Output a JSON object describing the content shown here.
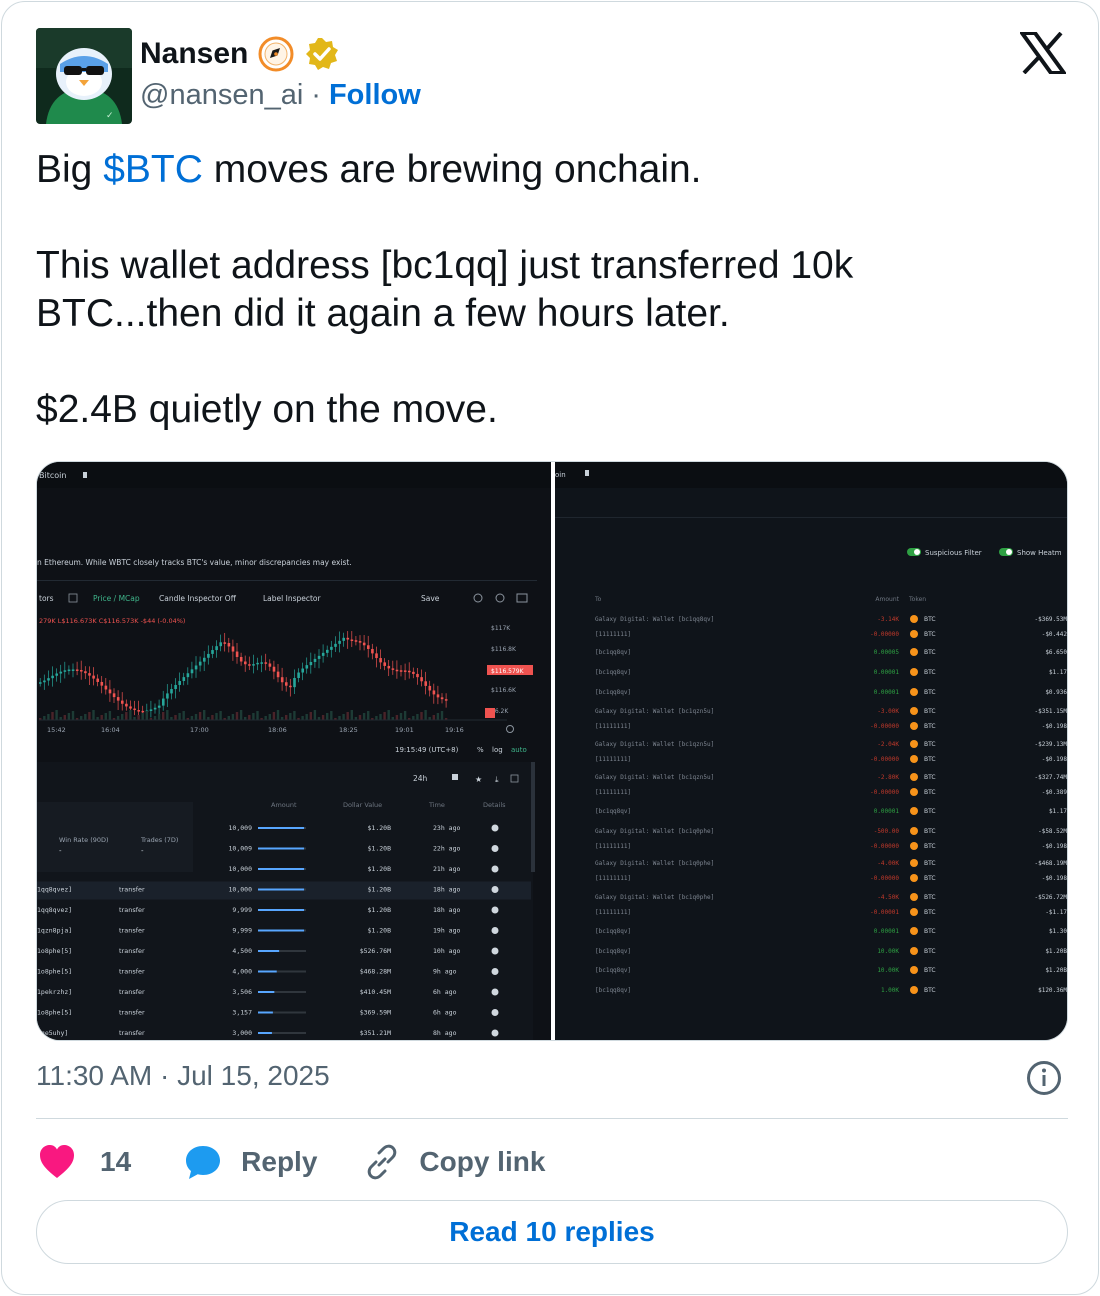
{
  "author": {
    "display_name": "Nansen",
    "handle": "@nansen_ai",
    "separator": "·",
    "follow_label": "Follow"
  },
  "tweet": {
    "line1_pre": "Big ",
    "cashtag": "$BTC",
    "line1_post": " moves are brewing onchain.",
    "para2": "This wallet address [bc1qq] just transferred 10k BTC...then did it again a few hours later.",
    "para3": "$2.4B quietly on the move."
  },
  "media": {
    "left": {
      "title": "Bitcoin",
      "notice": "n Ethereum. While WBTC closely tracks BTC's value, minor discrepancies may exist.",
      "toolbar": [
        "tors",
        "Price / MCap",
        "Candle Inspector Off",
        "Label Inspector",
        "Save"
      ],
      "ohlc": "279K L$116.673K C$116.573K -$44 (-0.04%)",
      "price_axis": [
        "$117K",
        "$116.8K",
        "$116.579K",
        "$116.6K",
        "16.2K"
      ],
      "time_axis": [
        "15:42",
        "16:04",
        "17:00",
        "18:06",
        "18:25",
        "19:01",
        "19:16"
      ],
      "clock": "19:15:49 (UTC+8)",
      "scale_opts": [
        "%",
        "log",
        "auto"
      ],
      "range": "24h",
      "col_headers": [
        "Amount",
        "Dollar Value",
        "Time",
        "Details"
      ],
      "stats": [
        "Win Rate (90D)",
        "Trades (7D)"
      ],
      "stat_values": [
        "-",
        "-"
      ],
      "rows": [
        {
          "addr": "",
          "type": "",
          "amount": "10,009",
          "value": "$1.20B",
          "time": "23h ago",
          "bar": 0.96
        },
        {
          "addr": "",
          "type": "",
          "amount": "10,009",
          "value": "$1.20B",
          "time": "22h ago",
          "bar": 0.96
        },
        {
          "addr": "",
          "type": "",
          "amount": "10,000",
          "value": "$1.20B",
          "time": "21h ago",
          "bar": 0.96
        },
        {
          "addr": "1qq8qvez]",
          "type": "transfer",
          "amount": "10,000",
          "value": "$1.20B",
          "time": "18h ago",
          "bar": 0.96
        },
        {
          "addr": "1qq8qvez]",
          "type": "transfer",
          "amount": "9,999",
          "value": "$1.20B",
          "time": "18h ago",
          "bar": 0.96
        },
        {
          "addr": "1qzn8pja]",
          "type": "transfer",
          "amount": "9,999",
          "value": "$1.20B",
          "time": "19h ago",
          "bar": 0.96
        },
        {
          "addr": "1o8phe[5]",
          "type": "transfer",
          "amount": "4,500",
          "value": "$526.76M",
          "time": "10h ago",
          "bar": 0.44
        },
        {
          "addr": "1o8phe[5]",
          "type": "transfer",
          "amount": "4,000",
          "value": "$468.28M",
          "time": "9h ago",
          "bar": 0.39
        },
        {
          "addr": "1pekrzhz]",
          "type": "transfer",
          "amount": "3,506",
          "value": "$410.45M",
          "time": "6h ago",
          "bar": 0.34
        },
        {
          "addr": "1o8phe[5]",
          "type": "transfer",
          "amount": "3,157",
          "value": "$369.59M",
          "time": "6h ago",
          "bar": 0.31
        },
        {
          "addr": "1qe5uhy]",
          "type": "transfer",
          "amount": "3,000",
          "value": "$351.21M",
          "time": "8h ago",
          "bar": 0.29
        }
      ]
    },
    "right": {
      "title": "oin",
      "toggles": [
        "Suspicious Filter",
        "Show Heatm"
      ],
      "col_headers": [
        "To",
        "Amount",
        "Token"
      ],
      "rows": [
        {
          "to": "Galaxy Digital: Wallet [bc1qq8qv]",
          "amount": "-3.14K",
          "token": "BTC",
          "value": "-$369.53M",
          "tone": "red"
        },
        {
          "to": "[11111111]",
          "amount": "-0.00000",
          "token": "BTC",
          "value": "-$0.442",
          "tone": "red"
        },
        {
          "to": "[bc1qq8qv]",
          "amount": "0.00005",
          "token": "BTC",
          "value": "$6.650",
          "tone": "green"
        },
        {
          "to": "[bc1qq8qv]",
          "amount": "0.00001",
          "token": "BTC",
          "value": "$1.17",
          "tone": "green"
        },
        {
          "to": "[bc1qq8qv]",
          "amount": "0.00001",
          "token": "BTC",
          "value": "$0.936",
          "tone": "green"
        },
        {
          "to": "Galaxy Digital: Wallet [bc1qzn5u]",
          "amount": "-3.00K",
          "token": "BTC",
          "value": "-$351.15M",
          "tone": "red"
        },
        {
          "to": "[11111111]",
          "amount": "-0.00000",
          "token": "BTC",
          "value": "-$0.198",
          "tone": "red"
        },
        {
          "to": "Galaxy Digital: Wallet [bc1qzn5u]",
          "amount": "-2.04K",
          "token": "BTC",
          "value": "-$239.13M",
          "tone": "red"
        },
        {
          "to": "[11111111]",
          "amount": "-0.00000",
          "token": "BTC",
          "value": "-$0.198",
          "tone": "red"
        },
        {
          "to": "Galaxy Digital: Wallet [bc1qzn5u]",
          "amount": "-2.80K",
          "token": "BTC",
          "value": "-$327.74M",
          "tone": "red"
        },
        {
          "to": "[11111111]",
          "amount": "-0.00000",
          "token": "BTC",
          "value": "-$0.389",
          "tone": "red"
        },
        {
          "to": "[bc1qq8qv]",
          "amount": "0.00001",
          "token": "BTC",
          "value": "$1.17",
          "tone": "green"
        },
        {
          "to": "Galaxy Digital: Wallet [bc1q0phe]",
          "amount": "-500.00",
          "token": "BTC",
          "value": "-$58.52M",
          "tone": "red"
        },
        {
          "to": "[11111111]",
          "amount": "-0.00000",
          "token": "BTC",
          "value": "-$0.198",
          "tone": "red"
        },
        {
          "to": "Galaxy Digital: Wallet [bc1q0phe]",
          "amount": "-4.00K",
          "token": "BTC",
          "value": "-$468.19M",
          "tone": "red"
        },
        {
          "to": "[11111111]",
          "amount": "-0.00000",
          "token": "BTC",
          "value": "-$0.198",
          "tone": "red"
        },
        {
          "to": "Galaxy Digital: Wallet [bc1q0phe]",
          "amount": "-4.50K",
          "token": "BTC",
          "value": "-$526.72M",
          "tone": "red"
        },
        {
          "to": "[11111111]",
          "amount": "-0.00001",
          "token": "BTC",
          "value": "-$1.17",
          "tone": "red"
        },
        {
          "to": "[bc1qq8qv]",
          "amount": "0.00001",
          "token": "BTC",
          "value": "$1.30",
          "tone": "green"
        },
        {
          "to": "[bc1qq8qv]",
          "amount": "10.00K",
          "token": "BTC",
          "value": "$1.20B",
          "tone": "green"
        },
        {
          "to": "[bc1qq8qv]",
          "amount": "10.00K",
          "token": "BTC",
          "value": "$1.20B",
          "tone": "green"
        },
        {
          "to": "[bc1qq8qv]",
          "amount": "1.00K",
          "token": "BTC",
          "value": "$120.36M",
          "tone": "green"
        }
      ]
    }
  },
  "meta": {
    "timestamp": "11:30 AM · Jul 15, 2025"
  },
  "actions": {
    "like_count": "14",
    "reply_label": "Reply",
    "copy_label": "Copy link"
  },
  "read_replies": "Read 10 replies",
  "colors": {
    "link": "#006fd6",
    "like": "#f91880",
    "reply": "#1d9bf0",
    "gray": "#536471",
    "border": "#cfd9de",
    "dark_bg": "#0d1117",
    "up_candle": "#26a69a",
    "down_candle": "#ef5350",
    "btc": "#f7931a"
  }
}
